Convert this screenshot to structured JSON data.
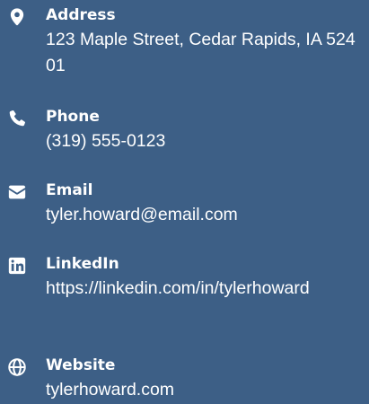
{
  "contact": {
    "address": {
      "label": "Address",
      "value": "123 Maple Street, Cedar Rapids, IA 52401",
      "icon": "map-marker-icon"
    },
    "phone": {
      "label": "Phone",
      "value": "(319) 555-0123",
      "icon": "phone-icon"
    },
    "email": {
      "label": "Email",
      "value": "tyler.howard@email.com",
      "icon": "envelope-icon"
    },
    "linkedin": {
      "label": "LinkedIn",
      "value": "https://linkedin.com/in/tylerhoward",
      "icon": "linkedin-icon"
    },
    "website": {
      "label": "Website",
      "value": "tylerhoward.com",
      "icon": "globe-icon"
    }
  },
  "colors": {
    "background": "#3d5f86",
    "text": "#ffffff"
  }
}
